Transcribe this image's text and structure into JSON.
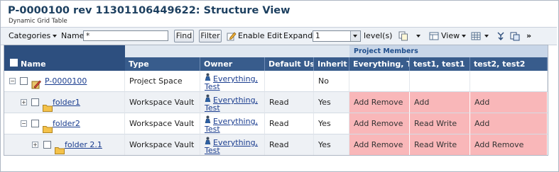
{
  "header": {
    "title": "P-0000100 rev 11301106449622: Structure View",
    "subtitle": "Dynamic Grid Table"
  },
  "toolbar": {
    "categories_label": "Categories",
    "name_label": "Name",
    "name_value": "*",
    "find_label": "Find",
    "filter_label": "Filter",
    "enable_edit_label": "Enable Edit",
    "expand_label": "Expand",
    "expand_value": "1",
    "levels_label": "level(s)",
    "view_label": "View",
    "more_label": "»"
  },
  "grid": {
    "group_header": "Project Members",
    "columns": [
      "Name",
      "Type",
      "Owner",
      "Default Use",
      "Inherit",
      "Everything, Te",
      "test1, test1",
      "test2, test2"
    ],
    "rows": [
      {
        "name": "P-0000100",
        "type": "Project Space",
        "owner_line1": "Everything,",
        "owner_line2": "Test",
        "default_use": "",
        "inherit": "No",
        "everything": "",
        "test1": "",
        "test2": "",
        "pink": false,
        "expander": "−"
      },
      {
        "name": "folder1",
        "type": "Workspace Vault",
        "owner_line1": "Everything,",
        "owner_line2": "Test",
        "default_use": "Read",
        "inherit": "Yes",
        "everything": "Add Remove",
        "test1": "Add",
        "test2": "Add",
        "pink": true,
        "expander": "+"
      },
      {
        "name": "folder2",
        "type": "Workspace Vault",
        "owner_line1": "Everything,",
        "owner_line2": "Test",
        "default_use": "Read",
        "inherit": "Yes",
        "everything": "Add Remove",
        "test1": "Read Write",
        "test2": "Add",
        "pink": true,
        "expander": "−"
      },
      {
        "name": "folder 2.1",
        "type": "Workspace Vault",
        "owner_line1": "Everything,",
        "owner_line2": "Test",
        "default_use": "Read",
        "inherit": "Yes",
        "everything": "Add Remove",
        "test1": "Read Write",
        "test2": "Add Remove",
        "pink": true,
        "expander": "+"
      }
    ]
  },
  "colors": {
    "header_blue": "#385c8c",
    "pink_cell": "#f9b7b9",
    "title_color": "#1c3f5f",
    "link_color": "#1a3d8f"
  },
  "icons": [
    "project-icon",
    "folder-icon",
    "person-icon",
    "copy-icon",
    "view-icon",
    "table-icon",
    "tree-icon",
    "export-icon"
  ]
}
